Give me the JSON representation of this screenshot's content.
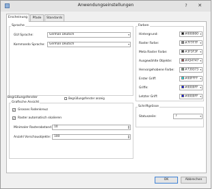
{
  "window": {
    "title": "Anwendungseinstellungen",
    "help_glyph": "?",
    "close_glyph": "✕"
  },
  "tabs": [
    "Erscheinung",
    "Pfade",
    "Standards"
  ],
  "sprache": {
    "title": "Sprache",
    "gui_label": "GUI Sprache:",
    "gui_value": "German Deutsch",
    "command_label": "Kommando Sprache:",
    "command_value": "German Deutsch"
  },
  "farben": {
    "title": "Farben",
    "rows": [
      {
        "label": "Hintergrund:",
        "value": "#000000",
        "color": "#000000"
      },
      {
        "label": "Raster Farbe:",
        "value": "#7F7F7F",
        "color": "#7F7F7F"
      },
      {
        "label": "Meta Raster Farbe:",
        "value": "#3F3F3F",
        "color": "#3F3F3F"
      },
      {
        "label": "Ausgewählte Objekte:",
        "value": "#A54747",
        "color": "#A54747"
      },
      {
        "label": "Hervorgehobene Farbe:",
        "value": "#739373",
        "color": "#739373"
      },
      {
        "label": "Erster Griff:",
        "value": "#00FFFF",
        "color": "#00FFFF"
      },
      {
        "label": "Griffe:",
        "value": "#0000FF",
        "color": "#0000FF"
      },
      {
        "label": "Letzter Griff:",
        "value": "#0000FF",
        "color": "#0000FF"
      }
    ]
  },
  "zeichenfenster": {
    "title": "Begrüßungsfenster",
    "option_label": "Begrüßungsfenster anzeig"
  },
  "grafische_ansicht": {
    "title": "Grafische Ansicht",
    "checks": [
      {
        "label": "Grosses Fadenkreuz",
        "checked": true
      },
      {
        "label": "Raster automatisch skalieren",
        "checked": true
      }
    ],
    "min_spacing_label": "Minimaler Rasterabstand (pix):",
    "min_spacing_value": "10",
    "preview_label": "Anzahl Vorschauobjekte:",
    "preview_value": "100"
  },
  "schriftgroesse": {
    "title": "Schriftgrösse",
    "label": "Statuszeile:",
    "value": "7"
  },
  "buttons": {
    "ok": "OK",
    "cancel": "Abbrechen"
  },
  "glyphs": {
    "dropdown": "▾",
    "spin_up": "▲",
    "spin_down": "▼",
    "check": "✓"
  }
}
